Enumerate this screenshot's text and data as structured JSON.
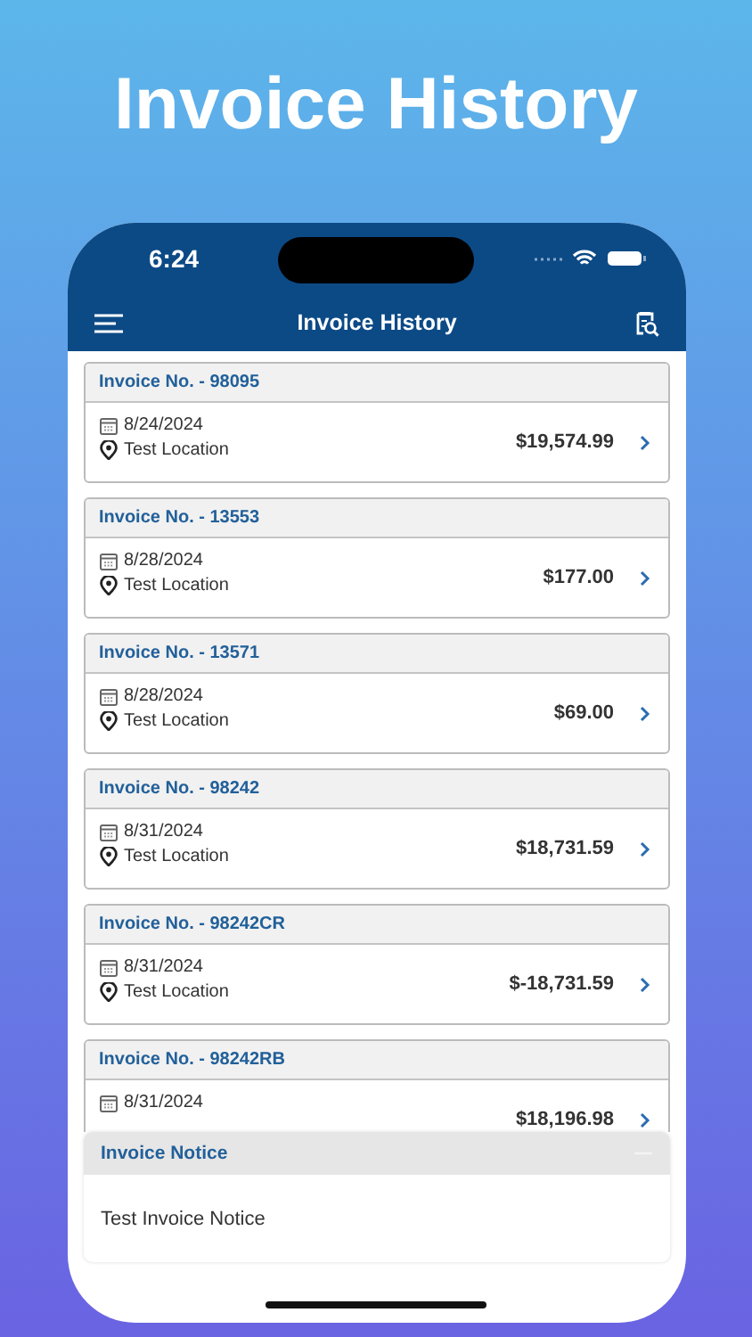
{
  "headline": "Invoice History",
  "status_bar": {
    "time": "6:24"
  },
  "nav": {
    "title": "Invoice History"
  },
  "invoices": [
    {
      "number": "Invoice No. - 98095",
      "date": "8/24/2024",
      "location": "Test Location",
      "amount": "$19,574.99"
    },
    {
      "number": "Invoice No. - 13553",
      "date": "8/28/2024",
      "location": "Test Location",
      "amount": "$177.00"
    },
    {
      "number": "Invoice No. - 13571",
      "date": "8/28/2024",
      "location": "Test Location",
      "amount": "$69.00"
    },
    {
      "number": "Invoice No. - 98242",
      "date": "8/31/2024",
      "location": "Test Location",
      "amount": "$18,731.59"
    },
    {
      "number": "Invoice No. - 98242CR",
      "date": "8/31/2024",
      "location": "Test Location",
      "amount": "$-18,731.59"
    },
    {
      "number": "Invoice No. - 98242RB",
      "date": "8/31/2024",
      "amount": "$18,196.98"
    }
  ],
  "notice": {
    "title": "Invoice Notice",
    "text": "Test Invoice Notice",
    "expanded": true
  }
}
